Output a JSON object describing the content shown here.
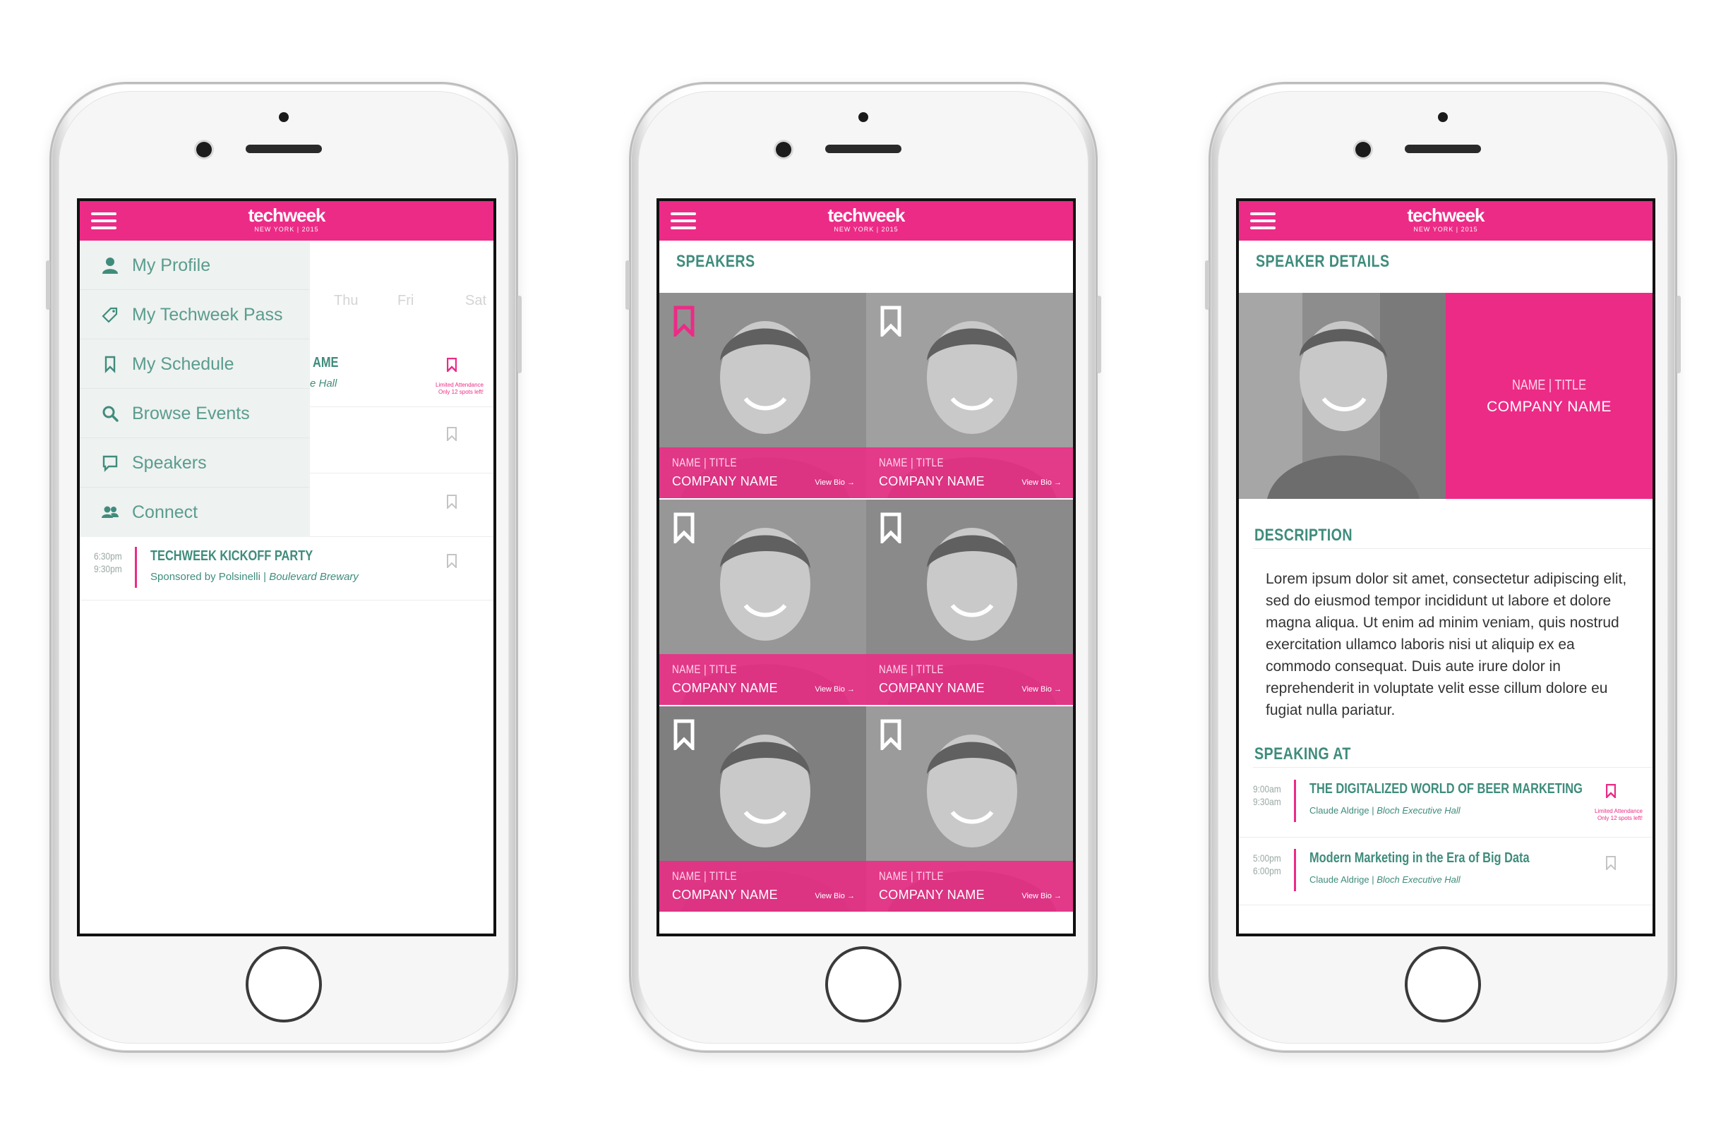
{
  "app": {
    "brand_logo": "techweek",
    "brand_sub": "NEW YORK | 2015",
    "accent_color": "#ec2b86",
    "text_color": "#3f8c7c"
  },
  "screen1": {
    "menu": [
      {
        "label": "My Profile",
        "icon": "user-icon"
      },
      {
        "label": "My Techweek Pass",
        "icon": "ticket-icon"
      },
      {
        "label": "My Schedule",
        "icon": "bookmark-icon"
      },
      {
        "label": "Browse Events",
        "icon": "search-icon"
      },
      {
        "label": "Speakers",
        "icon": "speech-bubble-icon"
      },
      {
        "label": "Connect",
        "icon": "people-icon"
      }
    ],
    "days": [
      "Thu",
      "Fri",
      "Sat"
    ],
    "partial_event": {
      "title_fragment": "AME",
      "sub_fragment": "e Hall",
      "limited_line1": "Limited Attendance",
      "limited_line2": "Only 12 spots left!"
    },
    "event": {
      "start": "6:30pm",
      "end": "9:30pm",
      "title": "TECHWEEK KICKOFF PARTY",
      "sponsor": "Sponsored by Polsinelli",
      "venue": "Boulevard Brewary"
    }
  },
  "screen2": {
    "title": "SPEAKERS",
    "speakers": [
      {
        "name_title": "NAME | TITLE",
        "company": "COMPANY NAME",
        "link": "View Bio",
        "saved": true
      },
      {
        "name_title": "NAME | TITLE",
        "company": "COMPANY NAME",
        "link": "View Bio",
        "saved": false
      },
      {
        "name_title": "NAME | TITLE",
        "company": "COMPANY NAME",
        "link": "View Bio",
        "saved": false
      },
      {
        "name_title": "NAME | TITLE",
        "company": "COMPANY NAME",
        "link": "View Bio",
        "saved": false
      },
      {
        "name_title": "NAME | TITLE",
        "company": "COMPANY NAME",
        "link": "View Bio",
        "saved": false
      },
      {
        "name_title": "NAME | TITLE",
        "company": "COMPANY NAME",
        "link": "View Bio",
        "saved": false
      }
    ]
  },
  "screen3": {
    "title": "SPEAKER DETAILS",
    "name_title": "NAME | TITLE",
    "company": "COMPANY NAME",
    "description_heading": "DESCRIPTION",
    "description": "Lorem ipsum dolor sit amet, consectetur adipiscing elit, sed do eiusmod tempor incididunt ut labore et dolore magna aliqua. Ut enim ad minim veniam, quis nostrud exercitation ullamco laboris nisi ut aliquip ex ea commodo consequat. Duis aute irure dolor in reprehenderit in voluptate velit esse cillum dolore eu fugiat nulla pariatur.",
    "speaking_heading": "SPEAKING AT",
    "sessions": [
      {
        "start": "9:00am",
        "end": "9:30am",
        "title": "THE DIGITALIZED WORLD OF BEER MARKETING",
        "speaker": "Claude Aldrige",
        "venue": "Bloch Executive Hall",
        "limited_line1": "Limited Attendance",
        "limited_line2": "Only 12 spots left!",
        "saved": true
      },
      {
        "start": "5:00pm",
        "end": "6:00pm",
        "title": "Modern Marketing in the Era of Big Data",
        "speaker": "Claude Aldrige",
        "venue": "Bloch Executive Hall",
        "saved": false
      }
    ]
  }
}
